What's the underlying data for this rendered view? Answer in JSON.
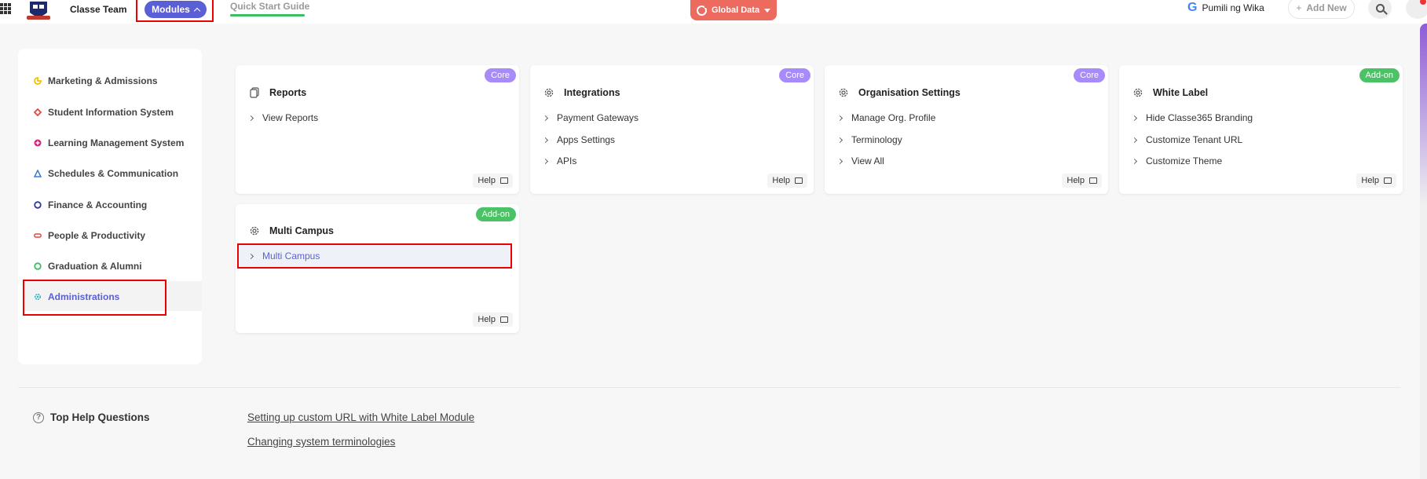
{
  "topbar": {
    "team_name": "Classe Team",
    "modules_label": "Modules",
    "quick_start": "Quick Start Guide",
    "global_data": "Global Data",
    "google_user": "Pumili ng Wika",
    "add_new": "Add New"
  },
  "sidebar": {
    "items": [
      {
        "label": "Marketing & Admissions",
        "color": "#f2c200"
      },
      {
        "label": "Student Information System",
        "color": "#e64545"
      },
      {
        "label": "Learning Management System",
        "color": "#d6247a"
      },
      {
        "label": "Schedules & Communication",
        "color": "#3a7bd5"
      },
      {
        "label": "Finance & Accounting",
        "color": "#2e3aa0"
      },
      {
        "label": "People & Productivity",
        "color": "#e64545"
      },
      {
        "label": "Graduation & Alumni",
        "color": "#3cbe63"
      },
      {
        "label": "Administrations",
        "color": "#26b5c4"
      }
    ]
  },
  "cards": [
    {
      "title": "Reports",
      "badge": "Core",
      "links": [
        "View Reports"
      ],
      "help": "Help"
    },
    {
      "title": "Integrations",
      "badge": "Core",
      "links": [
        "Payment Gateways",
        "Apps Settings",
        "APIs"
      ],
      "help": "Help"
    },
    {
      "title": "Organisation Settings",
      "badge": "Core",
      "links": [
        "Manage Org. Profile",
        "Terminology",
        "View All"
      ],
      "help": "Help"
    },
    {
      "title": "White Label",
      "badge": "Add-on",
      "links": [
        "Hide Classe365 Branding",
        "Customize Tenant URL",
        "Customize Theme"
      ],
      "help": "Help"
    },
    {
      "title": "Multi Campus",
      "badge": "Add-on",
      "links": [
        "Multi Campus"
      ],
      "help": "Help"
    }
  ],
  "help_questions": {
    "title": "Top Help Questions",
    "links": [
      "Setting up custom URL with White Label Module",
      "Changing system terminologies"
    ]
  },
  "colors": {
    "accent": "#5b5fd6",
    "global_data": "#ec6a5e",
    "core_badge": "#a78bfa",
    "addon_badge": "#4cc266",
    "highlight_border": "#e00000"
  }
}
